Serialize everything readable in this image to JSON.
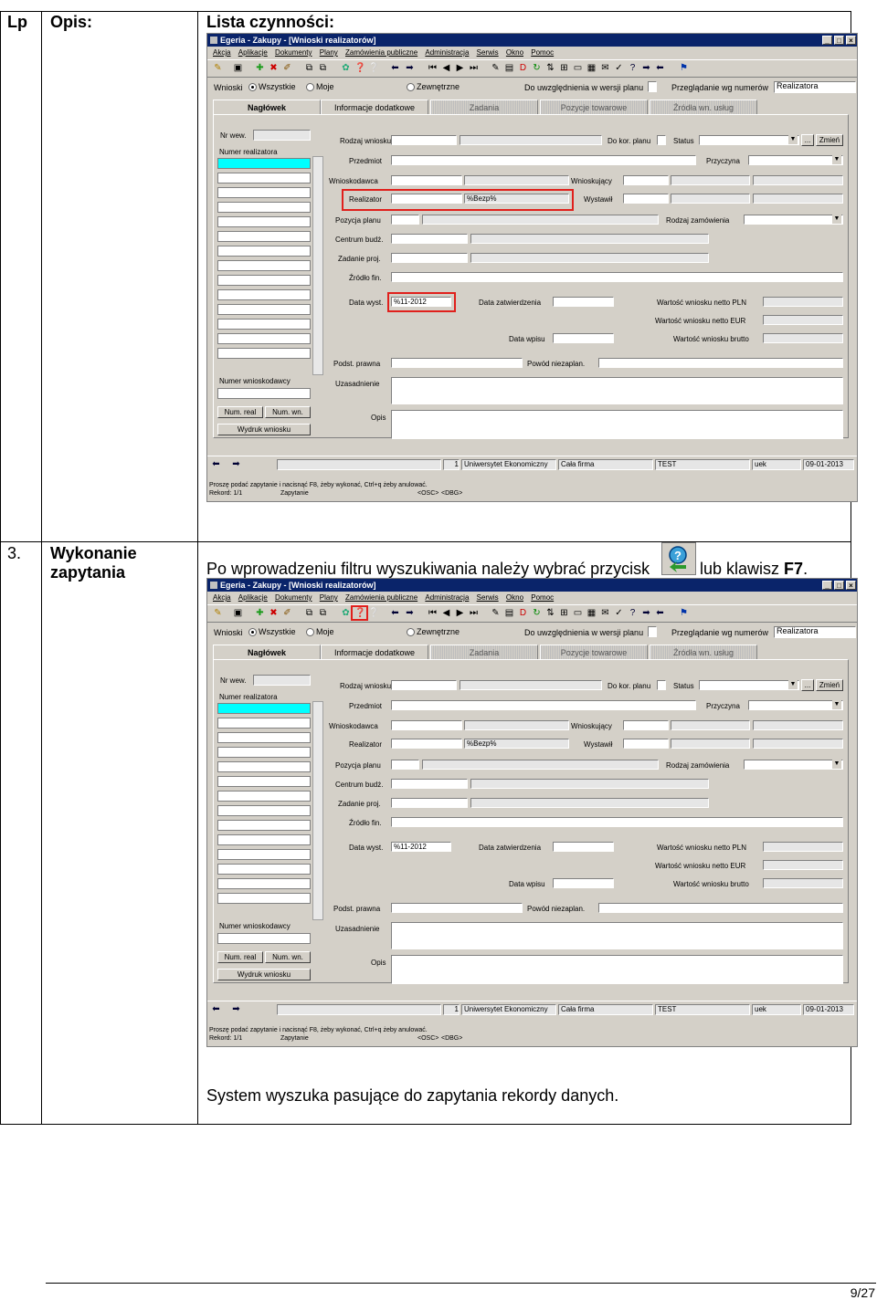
{
  "table": {
    "header_lp": "Lp",
    "header_opis": "Opis:",
    "header_lista": "Lista czynności:",
    "step_no": "3.",
    "step_title_1": "Wykonanie",
    "step_title_2": "zapytania",
    "instruction_pre": "Po wprowadzeniu filtru wyszukiwania należy wybrać przycisk",
    "instruction_mid": "lub klawisz",
    "instruction_key": "F7",
    "instruction_end": ".",
    "result_text": "System wyszuka pasujące do zapytania rekordy danych."
  },
  "window": {
    "title": "Egeria - Zakupy - [Wnioski realizatorów]",
    "menu": [
      "Akcja",
      "Aplikacje",
      "Dokumenty",
      "Plany",
      "Zamówienia publiczne",
      "Administracja",
      "Serwis",
      "Okno",
      "Pomoc"
    ],
    "filter_label": "Wnioski",
    "radio_all": "Wszystkie",
    "radio_mine": "Moje",
    "radio_external": "Zewnętrzne",
    "consider_label": "Do uwzględnienia w wersji planu",
    "browse_label": "Przeglądanie wg numerów",
    "browse_value": "Realizatora",
    "tabs": [
      "Nagłówek",
      "Informacje dodatkowe",
      "Zadania",
      "Pozycje towarowe",
      "Źródła wn. usług"
    ],
    "left": {
      "nr_wew": "Nr wew.",
      "numer_realizatora": "Numer realizatora",
      "numer_wnioskodawcy": "Numer wnioskodawcy",
      "btn_num_real": "Num. real",
      "btn_num_wn": "Num. wn.",
      "btn_wydruk": "Wydruk wniosku"
    },
    "labels": {
      "rodzaj_wniosku": "Rodzaj wniosku",
      "do_kor_planu": "Do kor. planu",
      "status": "Status",
      "zmien": "Zmień",
      "przedmiot": "Przedmiot",
      "przyczyna": "Przyczyna",
      "wnioskodawca": "Wnioskodawca",
      "wnioskujacy": "Wnioskujący",
      "realizator": "Realizator",
      "wystawil": "Wystawił",
      "pozycja_planu": "Pozycja planu",
      "rodzaj_zamowienia": "Rodzaj zamówienia",
      "centrum_budz": "Centrum budż.",
      "zadanie_proj": "Zadanie proj.",
      "zrodlo_fin": "Źródło fin.",
      "data_wyst": "Data wyst.",
      "data_zatwierdzenia": "Data zatwierdzenia",
      "wartosc_pln": "Wartość wniosku netto PLN",
      "wartosc_eur": "Wartość wniosku netto EUR",
      "data_wpisu": "Data wpisu",
      "wartosc_brutto": "Wartość wniosku brutto",
      "podst_prawna": "Podst. prawna",
      "powod_niezaplan": "Powód niezaplan.",
      "uzasadnienie": "Uzasadnienie",
      "opis": "Opis"
    },
    "values": {
      "realizator": "%Bezp%",
      "data_wyst": "%11-2012"
    },
    "statusbar": {
      "record_no": "1",
      "org": "Uniwersytet Ekonomiczny",
      "firm": "Cała firma",
      "env": "TEST",
      "user": "uek",
      "date": "09-01-2013"
    },
    "hint": "Proszę podać zapytanie i nacisnąć F8, żeby wykonać, Ctrl+q  żeby anulować.",
    "rekord": "Rekord: 1/1",
    "zapytanie": "Zapytanie",
    "osc": "<OSC>",
    "dbg": "<DBG>"
  },
  "page": {
    "number": "9/27"
  }
}
